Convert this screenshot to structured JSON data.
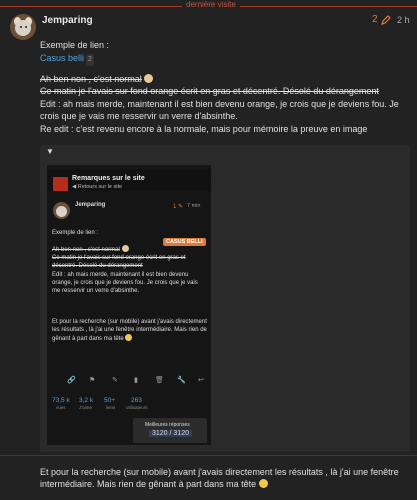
{
  "divider_label": "dernière visite",
  "post": {
    "username": "Jemparing",
    "edit_count": "2",
    "time": "2 h",
    "line1": "Exemple de lien :",
    "link_text": "Casus belli",
    "link_badge": "2",
    "strike1": "Ah ben non , c'est normal",
    "strike2": "Ce matin je l'avais sur fond orange écrit en gras et décentré. Désolé du dérangement",
    "edit_line": "Edit : ah mais merde, maintenant il est bien devenu orange, je crois que je deviens fou. Je crois que je vais me resservir un verre d'absinthe.",
    "reedit_line": "Re edit : c'est revenu encore à la normale, mais pour mémoire la preuve en image",
    "closing": "Et pour la recherche (sur mobile) avant j'avais directement les résultats , là j'ai une fenêtre intermédiaire. Mais rien de gênant à part dans ma tête"
  },
  "details": {
    "toggle": "▼"
  },
  "screenshot": {
    "site_title": "Remarques sur le site",
    "site_back": "◀ Retours sur le site",
    "username": "Jemparing",
    "edit_count": "1",
    "time": "7 min",
    "line1": "Exemple de lien :",
    "badge": "CASUS BELLI",
    "strike1": "Ah ben non , c'est normal",
    "strike2": "Ce matin je l'avais sur fond orange écrit en gras et décentré. Désolé du dérangement",
    "edit_line": "Edit : ah mais merde, maintenant il est bien devenu orange, je crois que je deviens fou. Je crois que je vais me resservir un verre d'absinthe.",
    "closing": "Et pour la recherche (sur mobile) avant j'avais directement les résultats , là j'ai une fenêtre intermédiaire. Mais rien de gênant à part dans ma tête",
    "stats": [
      {
        "num": "73,5 k",
        "label": "vues"
      },
      {
        "num": "3,2 k",
        "label": "J'aime"
      },
      {
        "num": "50+",
        "label": "liens"
      },
      {
        "num": "263",
        "label": "utilisateurs"
      }
    ],
    "map_title": "Meilleures réponses",
    "map_counter": "3120 / 3120"
  }
}
